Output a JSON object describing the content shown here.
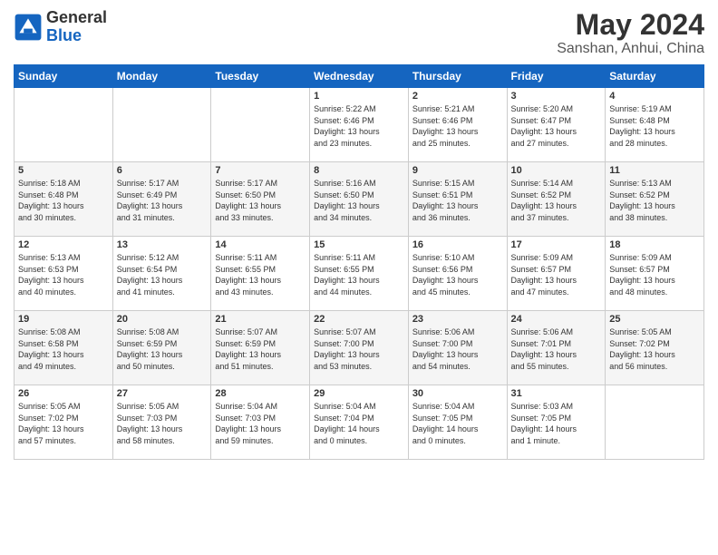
{
  "header": {
    "logo_general": "General",
    "logo_blue": "Blue",
    "month_year": "May 2024",
    "location": "Sanshan, Anhui, China"
  },
  "days_of_week": [
    "Sunday",
    "Monday",
    "Tuesday",
    "Wednesday",
    "Thursday",
    "Friday",
    "Saturday"
  ],
  "weeks": [
    [
      {
        "day": "",
        "info": ""
      },
      {
        "day": "",
        "info": ""
      },
      {
        "day": "",
        "info": ""
      },
      {
        "day": "1",
        "info": "Sunrise: 5:22 AM\nSunset: 6:46 PM\nDaylight: 13 hours\nand 23 minutes."
      },
      {
        "day": "2",
        "info": "Sunrise: 5:21 AM\nSunset: 6:46 PM\nDaylight: 13 hours\nand 25 minutes."
      },
      {
        "day": "3",
        "info": "Sunrise: 5:20 AM\nSunset: 6:47 PM\nDaylight: 13 hours\nand 27 minutes."
      },
      {
        "day": "4",
        "info": "Sunrise: 5:19 AM\nSunset: 6:48 PM\nDaylight: 13 hours\nand 28 minutes."
      }
    ],
    [
      {
        "day": "5",
        "info": "Sunrise: 5:18 AM\nSunset: 6:48 PM\nDaylight: 13 hours\nand 30 minutes."
      },
      {
        "day": "6",
        "info": "Sunrise: 5:17 AM\nSunset: 6:49 PM\nDaylight: 13 hours\nand 31 minutes."
      },
      {
        "day": "7",
        "info": "Sunrise: 5:17 AM\nSunset: 6:50 PM\nDaylight: 13 hours\nand 33 minutes."
      },
      {
        "day": "8",
        "info": "Sunrise: 5:16 AM\nSunset: 6:50 PM\nDaylight: 13 hours\nand 34 minutes."
      },
      {
        "day": "9",
        "info": "Sunrise: 5:15 AM\nSunset: 6:51 PM\nDaylight: 13 hours\nand 36 minutes."
      },
      {
        "day": "10",
        "info": "Sunrise: 5:14 AM\nSunset: 6:52 PM\nDaylight: 13 hours\nand 37 minutes."
      },
      {
        "day": "11",
        "info": "Sunrise: 5:13 AM\nSunset: 6:52 PM\nDaylight: 13 hours\nand 38 minutes."
      }
    ],
    [
      {
        "day": "12",
        "info": "Sunrise: 5:13 AM\nSunset: 6:53 PM\nDaylight: 13 hours\nand 40 minutes."
      },
      {
        "day": "13",
        "info": "Sunrise: 5:12 AM\nSunset: 6:54 PM\nDaylight: 13 hours\nand 41 minutes."
      },
      {
        "day": "14",
        "info": "Sunrise: 5:11 AM\nSunset: 6:55 PM\nDaylight: 13 hours\nand 43 minutes."
      },
      {
        "day": "15",
        "info": "Sunrise: 5:11 AM\nSunset: 6:55 PM\nDaylight: 13 hours\nand 44 minutes."
      },
      {
        "day": "16",
        "info": "Sunrise: 5:10 AM\nSunset: 6:56 PM\nDaylight: 13 hours\nand 45 minutes."
      },
      {
        "day": "17",
        "info": "Sunrise: 5:09 AM\nSunset: 6:57 PM\nDaylight: 13 hours\nand 47 minutes."
      },
      {
        "day": "18",
        "info": "Sunrise: 5:09 AM\nSunset: 6:57 PM\nDaylight: 13 hours\nand 48 minutes."
      }
    ],
    [
      {
        "day": "19",
        "info": "Sunrise: 5:08 AM\nSunset: 6:58 PM\nDaylight: 13 hours\nand 49 minutes."
      },
      {
        "day": "20",
        "info": "Sunrise: 5:08 AM\nSunset: 6:59 PM\nDaylight: 13 hours\nand 50 minutes."
      },
      {
        "day": "21",
        "info": "Sunrise: 5:07 AM\nSunset: 6:59 PM\nDaylight: 13 hours\nand 51 minutes."
      },
      {
        "day": "22",
        "info": "Sunrise: 5:07 AM\nSunset: 7:00 PM\nDaylight: 13 hours\nand 53 minutes."
      },
      {
        "day": "23",
        "info": "Sunrise: 5:06 AM\nSunset: 7:00 PM\nDaylight: 13 hours\nand 54 minutes."
      },
      {
        "day": "24",
        "info": "Sunrise: 5:06 AM\nSunset: 7:01 PM\nDaylight: 13 hours\nand 55 minutes."
      },
      {
        "day": "25",
        "info": "Sunrise: 5:05 AM\nSunset: 7:02 PM\nDaylight: 13 hours\nand 56 minutes."
      }
    ],
    [
      {
        "day": "26",
        "info": "Sunrise: 5:05 AM\nSunset: 7:02 PM\nDaylight: 13 hours\nand 57 minutes."
      },
      {
        "day": "27",
        "info": "Sunrise: 5:05 AM\nSunset: 7:03 PM\nDaylight: 13 hours\nand 58 minutes."
      },
      {
        "day": "28",
        "info": "Sunrise: 5:04 AM\nSunset: 7:03 PM\nDaylight: 13 hours\nand 59 minutes."
      },
      {
        "day": "29",
        "info": "Sunrise: 5:04 AM\nSunset: 7:04 PM\nDaylight: 14 hours\nand 0 minutes."
      },
      {
        "day": "30",
        "info": "Sunrise: 5:04 AM\nSunset: 7:05 PM\nDaylight: 14 hours\nand 0 minutes."
      },
      {
        "day": "31",
        "info": "Sunrise: 5:03 AM\nSunset: 7:05 PM\nDaylight: 14 hours\nand 1 minute."
      },
      {
        "day": "",
        "info": ""
      }
    ]
  ]
}
